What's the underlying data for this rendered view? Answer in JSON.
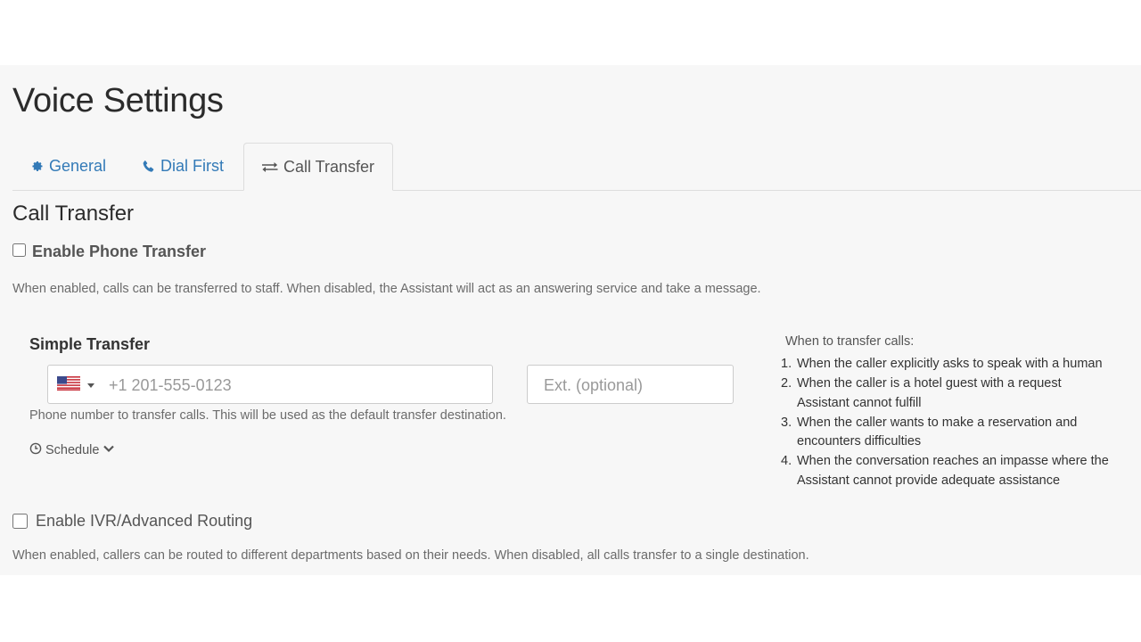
{
  "page": {
    "title": "Voice Settings"
  },
  "tabs": [
    {
      "label": "General",
      "icon": "gear-icon",
      "active": false
    },
    {
      "label": "Dial First",
      "icon": "phone-icon",
      "active": false
    },
    {
      "label": "Call Transfer",
      "icon": "exchange-icon",
      "active": true
    }
  ],
  "call_transfer": {
    "section_title": "Call Transfer",
    "enable_phone_transfer": {
      "label": "Enable Phone Transfer",
      "checked": false,
      "help": "When enabled, calls can be transferred to staff. When disabled, the Assistant will act as an answering service and take a message."
    },
    "simple_transfer": {
      "title": "Simple Transfer",
      "country_flag": "us-flag-icon",
      "phone": {
        "value": "",
        "placeholder": "+1 201-555-0123"
      },
      "ext": {
        "value": "",
        "placeholder": "Ext. (optional)"
      },
      "help": "Phone number to transfer calls. This will be used as the default transfer destination.",
      "schedule_label": "Schedule"
    },
    "when_to_transfer": {
      "title": "When to transfer calls:",
      "items": [
        {
          "num": "1.",
          "text": "When the caller explicitly asks to speak with a human"
        },
        {
          "num": "2.",
          "text": "When the caller is a hotel guest with a request Assistant cannot fulfill"
        },
        {
          "num": "3.",
          "text": "When the caller wants to make a reservation and encounters difficulties"
        },
        {
          "num": "4.",
          "text": "When the conversation reaches an impasse where the Assistant cannot provide adequate assistance"
        }
      ]
    },
    "enable_ivr": {
      "label": "Enable IVR/Advanced Routing",
      "checked": false,
      "help": "When enabled, callers can be routed to different departments based on their needs. When disabled, all calls transfer to a single destination."
    }
  },
  "colors": {
    "link": "#337ab7",
    "panel_bg": "#f7f7f7"
  }
}
